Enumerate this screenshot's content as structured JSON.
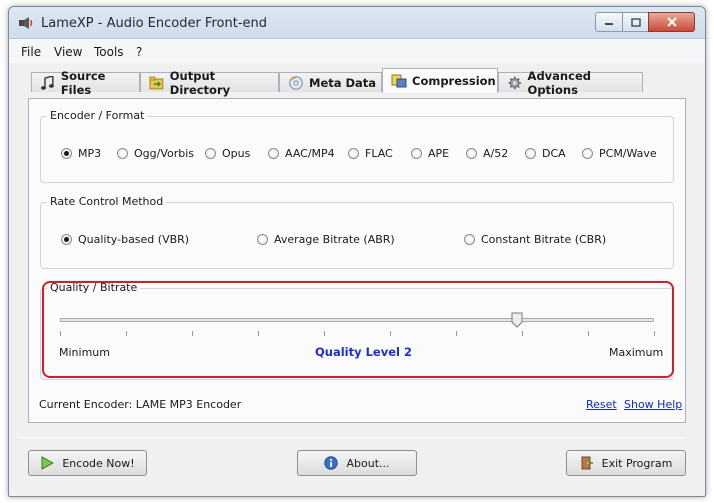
{
  "window": {
    "title": "LameXP - Audio Encoder Front-end"
  },
  "menu": [
    "File",
    "View",
    "Tools",
    "?"
  ],
  "tabs": [
    {
      "label": "Source Files",
      "icon": "music-note-icon"
    },
    {
      "label": "Output Directory",
      "icon": "folder-arrow-icon"
    },
    {
      "label": "Meta Data",
      "icon": "cd-icon"
    },
    {
      "label": "Compression",
      "icon": "compression-icon",
      "active": true
    },
    {
      "label": "Advanced Options",
      "icon": "gear-icon"
    }
  ],
  "encoder_group": {
    "title": "Encoder / Format",
    "options": [
      "MP3",
      "Ogg/Vorbis",
      "Opus",
      "AAC/MP4",
      "FLAC",
      "APE",
      "A/52",
      "DCA",
      "PCM/Wave"
    ],
    "selected": "MP3"
  },
  "rate_group": {
    "title": "Rate Control Method",
    "options": [
      "Quality-based (VBR)",
      "Average Bitrate (ABR)",
      "Constant Bitrate (CBR)"
    ],
    "selected": "Quality-based (VBR)"
  },
  "quality_group": {
    "title": "Quality / Bitrate",
    "min_label": "Minimum",
    "max_label": "Maximum",
    "level_label": "Quality Level 2",
    "slider_fraction": 0.77
  },
  "footer": {
    "current_encoder": "Current Encoder: LAME MP3 Encoder",
    "reset": "Reset",
    "show_help": "Show Help"
  },
  "buttons": {
    "encode": "Encode Now!",
    "about": "About...",
    "exit": "Exit Program"
  },
  "colors": {
    "highlight": "#d11f2f",
    "link": "#0f2bb8",
    "level": "#1e2fd0"
  }
}
